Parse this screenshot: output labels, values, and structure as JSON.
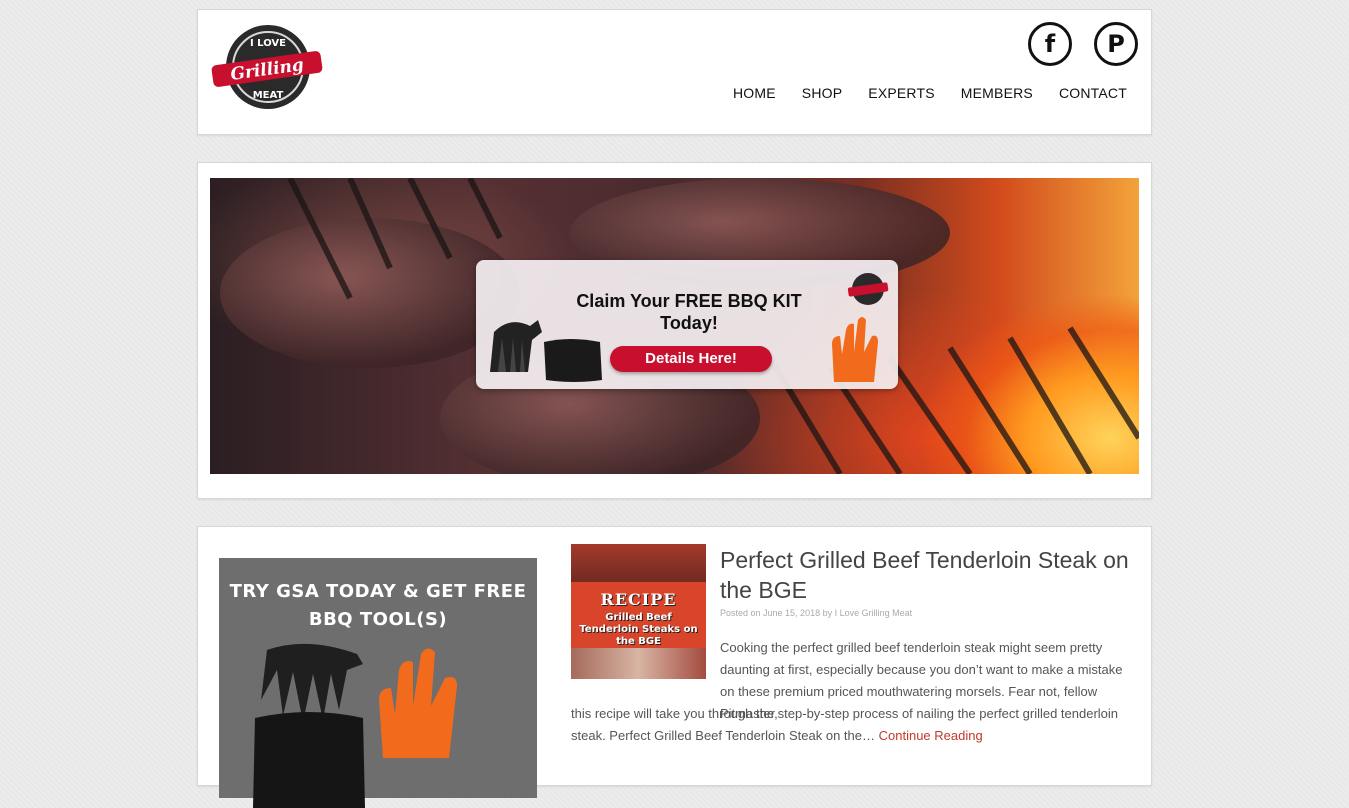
{
  "header": {
    "logo_text": {
      "top": "I LOVE",
      "middle": "Grilling",
      "bottom": "MEAT"
    },
    "social": [
      {
        "name": "facebook-icon",
        "glyph": "f"
      },
      {
        "name": "pinterest-icon",
        "glyph": "P"
      }
    ],
    "nav": [
      "HOME",
      "SHOP",
      "EXPERTS",
      "MEMBERS",
      "CONTACT"
    ]
  },
  "banner": {
    "promo_title": "Claim Your FREE BBQ KIT Today!",
    "promo_button": "Details Here!"
  },
  "sidebar_ad": {
    "title": "TRY GSA TODAY & GET FREE BBQ TOOL(S)"
  },
  "post": {
    "thumb_recipe": "RECIPE",
    "thumb_sub": "Grilled Beef Tenderloin Steaks on the BGE",
    "title": "Perfect Grilled Beef Tenderloin Steak on the BGE",
    "meta": "Posted on June 15, 2018 by I Love Grilling Meat",
    "excerpt_a": "Cooking the perfect grilled beef tenderloin steak might seem pretty daunting at first, especially because you don’t want to make a mistake on these premium priced mouthwatering morsels. Fear not, fellow Pitmaster,",
    "excerpt_b": "this recipe will take you through the step-by-step process of nailing the perfect grilled tenderloin steak. Perfect Grilled Beef Tenderloin Steak on the…",
    "read_more": "Continue Reading"
  },
  "colors": {
    "accent_red": "#c8102e",
    "link_red": "#c0392b"
  }
}
